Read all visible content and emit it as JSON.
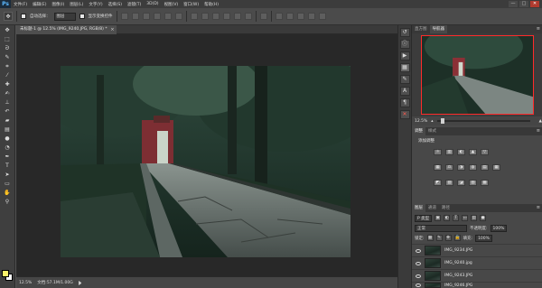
{
  "app": {
    "logo": "Ps"
  },
  "menu": [
    "文件(F)",
    "编辑(E)",
    "图像(I)",
    "图层(L)",
    "文字(Y)",
    "选择(S)",
    "滤镜(T)",
    "3D(D)",
    "视图(V)",
    "窗口(W)",
    "帮助(H)"
  ],
  "window_controls": [
    "—",
    "□",
    "✕"
  ],
  "options_bar": {
    "auto_select_label": "自动选择：",
    "auto_select_target": "图层",
    "show_transform_label": "显示变换控件"
  },
  "document": {
    "tab_title": "未标题-1 @ 12.5% (IMG_9240.JPG, RGB/8) *",
    "close_glyph": "×"
  },
  "status_bar": {
    "zoom": "12.5%",
    "doc_size": "文档:57.1M/1.00G"
  },
  "navigator": {
    "tabs": [
      "直方图",
      "导航器"
    ],
    "active_tab": 1,
    "zoom": "12.5%"
  },
  "adjustments": {
    "tabs": [
      "调整",
      "样式"
    ],
    "active_tab": 0,
    "title": "添加调整",
    "row1": [
      "☼",
      "▥",
      "◐",
      "▲",
      "▽"
    ],
    "row2": [
      "▦",
      "⚖",
      "◑",
      "◍",
      "▤",
      "▦"
    ],
    "row3": [
      "◩",
      "▨",
      "◪",
      "▧",
      "▩"
    ]
  },
  "layers": {
    "tabs": [
      "图层",
      "通道",
      "路径"
    ],
    "active_tab": 0,
    "filter_label": "P 类型",
    "blend_mode": "正常",
    "opacity_label": "不透明度:",
    "opacity_value": "100%",
    "lock_label": "锁定:",
    "fill_label": "填充:",
    "fill_value": "100%",
    "items": [
      {
        "name": "IMG_9234.JPG"
      },
      {
        "name": "IMG_9240.jpg"
      },
      {
        "name": "IMG_9243.JPG"
      },
      {
        "name": "IMG_9246.JPG"
      }
    ]
  },
  "icons": {
    "toolbox": [
      "move-icon",
      "marquee-icon",
      "lasso-icon",
      "quick-select-icon",
      "crop-icon",
      "eyedropper-icon",
      "healing-icon",
      "brush-icon",
      "stamp-icon",
      "history-brush-icon",
      "eraser-icon",
      "gradient-icon",
      "blur-icon",
      "dodge-icon",
      "pen-icon",
      "type-icon",
      "path-select-icon",
      "shape-icon",
      "hand-icon",
      "zoom-icon"
    ],
    "colors": {
      "foreground": "#fbf26b",
      "background": "#ffffff"
    }
  }
}
